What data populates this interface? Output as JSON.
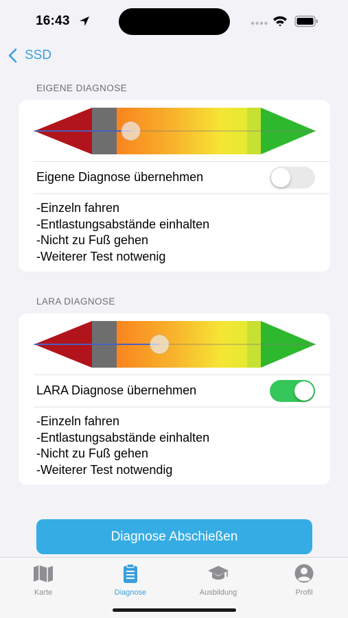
{
  "status_bar": {
    "time": "16:43"
  },
  "nav": {
    "back_label": "SSD"
  },
  "sections": [
    {
      "header": "EIGENE DIAGNOSE",
      "toggle_label": "Eigene Diagnose übernehmen",
      "toggle_on": false,
      "slider_value": 0.23,
      "lines": [
        "-Einzeln fahren",
        "-Entlastungsabstände einhalten",
        "-Nicht zu Fuß gehen",
        "-Weiterer Test notwenig"
      ]
    },
    {
      "header": "LARA DIAGNOSE",
      "toggle_label": "LARA Diagnose übernehmen",
      "toggle_on": true,
      "slider_value": 0.4,
      "lines": [
        "-Einzeln fahren",
        "-Entlastungsabstände einhalten",
        "-Nicht zu Fuß gehen",
        "-Weiterer Test notwendig"
      ]
    }
  ],
  "action": {
    "label": "Diagnose Abschießen"
  },
  "tabs": [
    {
      "label": "Karte",
      "icon": "map-icon",
      "active": false
    },
    {
      "label": "Diagnose",
      "icon": "clipboard-icon",
      "active": true
    },
    {
      "label": "Ausbildung",
      "icon": "graduation-cap-icon",
      "active": false
    },
    {
      "label": "Profil",
      "icon": "person-circle-icon",
      "active": false
    }
  ],
  "colors": {
    "accent": "#3aa0dc",
    "toggle_on": "#35c759",
    "button": "#35ace4",
    "scale_red": "#b2141b",
    "scale_gray": "#6e6e6e",
    "scale_green": "#2eb82e"
  }
}
